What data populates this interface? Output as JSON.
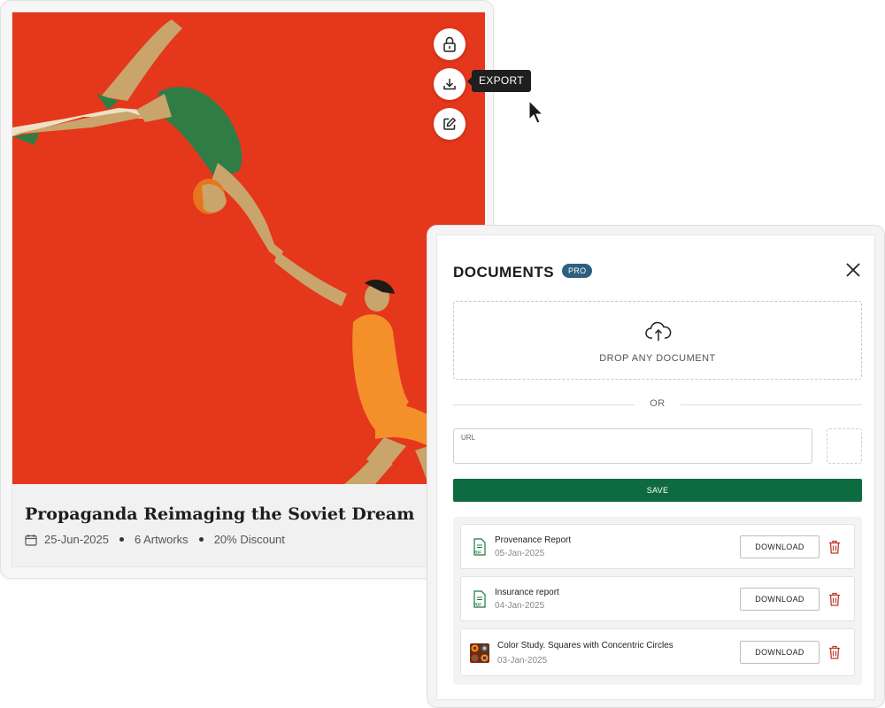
{
  "artwork": {
    "title": "Propaganda Reimaging the Soviet Dream",
    "date": "25-Jun-2025",
    "artworks_count": "6 Artworks",
    "discount": "20% Discount"
  },
  "actions": {
    "lock_icon": "lock-icon",
    "export_icon": "download-icon",
    "edit_icon": "edit-icon",
    "tooltip": "EXPORT"
  },
  "documents_panel": {
    "title": "DOCUMENTS",
    "badge": "PRO",
    "dropzone_label": "DROP ANY DOCUMENT",
    "or_label": "OR",
    "url_label": "URL",
    "url_value": "",
    "save_label": "SAVE",
    "download_label": "DOWNLOAD",
    "items": [
      {
        "name": "Provenance Report",
        "date": "05-Jan-2025",
        "icon": "pdf-file-icon"
      },
      {
        "name": "Insurance report",
        "date": "04-Jan-2025",
        "icon": "pdf-file-icon"
      },
      {
        "name": "Color Study. Squares with Concentric Circles",
        "date": "03-Jan-2025",
        "icon": "image-thumbnail"
      }
    ]
  },
  "colors": {
    "artwork_background": "#e5371b",
    "save_button": "#0e6a3f",
    "pro_badge": "#2e5f80",
    "delete_icon": "#c0392b",
    "pdf_icon": "#1b7a43"
  }
}
